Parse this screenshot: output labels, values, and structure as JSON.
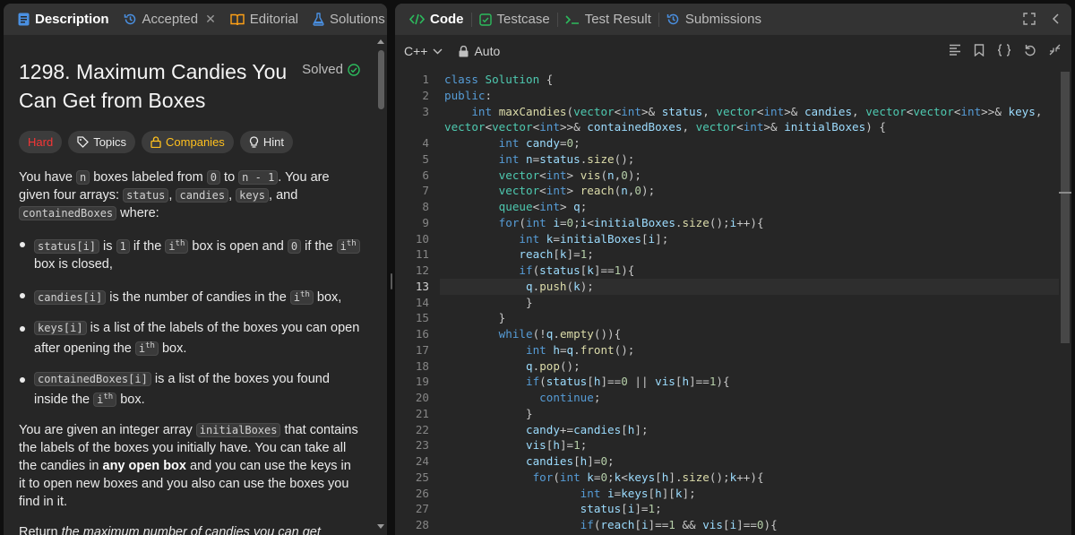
{
  "left_tabs": [
    {
      "label": "Description",
      "icon": "description-icon"
    },
    {
      "label": "Accepted",
      "icon": "history-icon"
    },
    {
      "label": "Editorial",
      "icon": "book-icon"
    },
    {
      "label": "Solutions",
      "icon": "flask-icon"
    }
  ],
  "problem": {
    "title": "1298. Maximum Candies You Can Get from Boxes",
    "status": "Solved",
    "tags": [
      "Hard",
      "Topics",
      "Companies",
      "Hint"
    ]
  },
  "description": {
    "p1_a": "You have ",
    "p1_n": "n",
    "p1_b": " boxes labeled from ",
    "p1_zero": "0",
    "p1_c": " to ",
    "p1_nm1": "n - 1",
    "p1_d": ". You are given four arrays: ",
    "arr1": "status",
    "arr2": "candies",
    "arr3": "keys",
    "p1_and": ", and ",
    "arr4": "containedBoxes",
    "p1_e": " where:",
    "b1_code": "status[i]",
    "b1_is": " is ",
    "b1_one": "1",
    "b1_a": " if the ",
    "ith": "i",
    "th": "th",
    "b1_b": " box is open and ",
    "b1_zero": "0",
    "b1_c": " if the ",
    "b1_d": " box is closed,",
    "b2_code": "candies[i]",
    "b2_a": " is the number of candies in the ",
    "b2_b": " box,",
    "b3_code": "keys[i]",
    "b3_a": " is a list of the labels of the boxes you can open after opening the ",
    "b3_b": " box.",
    "b4_code": "containedBoxes[i]",
    "b4_a": " is a list of the boxes you found inside the ",
    "b4_b": " box.",
    "p2_a": "You are given an integer array ",
    "p2_code": "initialBoxes",
    "p2_b": " that contains the labels of the boxes you initially have. You can take all the candies in ",
    "p2_bold": "any open box",
    "p2_c": " and you can use the keys in it to open new boxes and you also can use the boxes you find in it.",
    "p3_a": "Return ",
    "p3_i": "the maximum number of candies you can get following the rules above",
    "p3_b": "."
  },
  "right_tabs": [
    {
      "label": "Code",
      "icon": "code-icon"
    },
    {
      "label": "Testcase",
      "icon": "checkbox-icon"
    },
    {
      "label": "Test Result",
      "icon": "terminal-icon"
    },
    {
      "label": "Submissions",
      "icon": "history-icon"
    }
  ],
  "editor": {
    "language": "C++",
    "mode": "Auto",
    "current_line": 13,
    "line_numbers": [
      "1",
      "2",
      "3",
      "",
      "4",
      "5",
      "6",
      "7",
      "8",
      "9",
      "10",
      "11",
      "12",
      "13",
      "14",
      "15",
      "16",
      "17",
      "18",
      "19",
      "20",
      "21",
      "22",
      "23",
      "24",
      "25",
      "26",
      "27",
      "28"
    ]
  },
  "colors": {
    "hard": "#f63636",
    "companies": "#ffc01e",
    "solved_check": "#2cbb5d",
    "code_tab_icon": "#2cbb5d"
  }
}
